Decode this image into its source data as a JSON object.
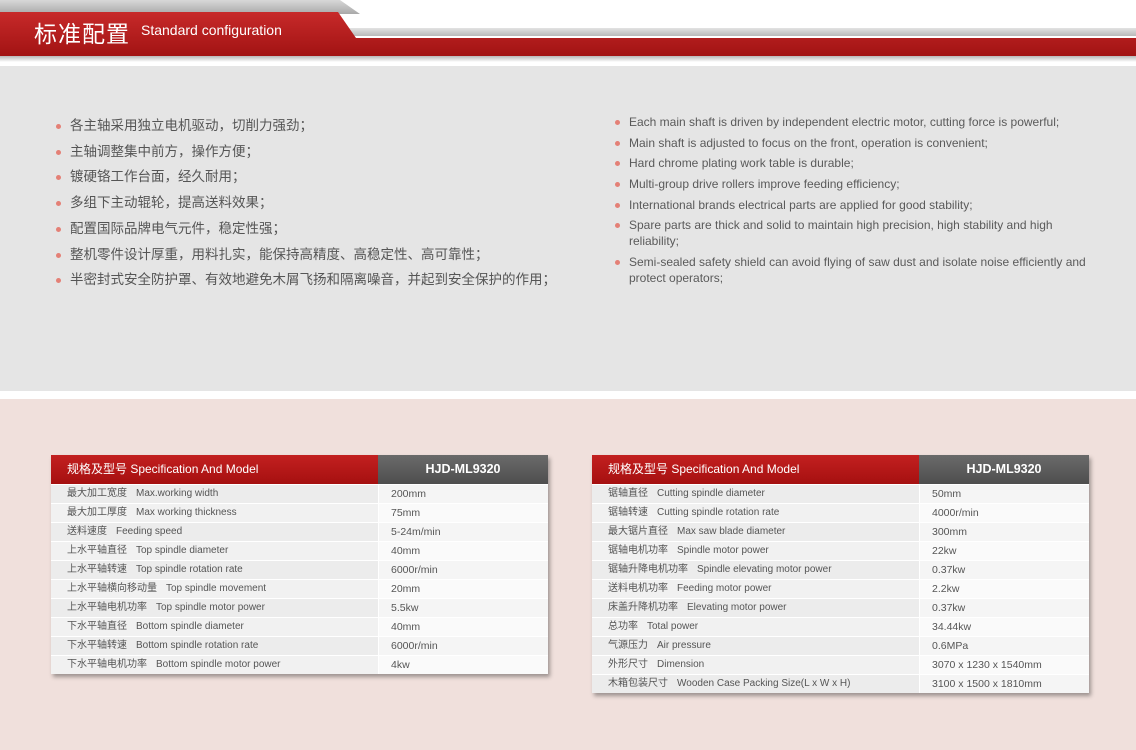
{
  "header": {
    "title_cn": "标准配置",
    "title_en": "Standard configuration",
    "accent": "#b71c1c"
  },
  "features_cn": [
    "各主轴采用独立电机驱动，切削力强劲；",
    "主轴调整集中前方，操作方便；",
    "镀硬铬工作台面，经久耐用；",
    "多组下主动辊轮，提高送料效果；",
    "配置国际品牌电气元件，稳定性强；",
    "整机零件设计厚重，用料扎实，能保持高精度、高稳定性、高可靠性；",
    "半密封式安全防护罩、有效地避免木屑飞扬和隔离噪音，并起到安全保护的作用；"
  ],
  "features_en": [
    "Each main shaft is driven by independent electric motor, cutting force is powerful;",
    "Main shaft is adjusted to focus on the front, operation is convenient;",
    "Hard chrome plating work table is durable;",
    "Multi-group drive rollers improve feeding efficiency;",
    "International brands electrical parts are applied for good stability;",
    "Spare parts are thick and solid to maintain high precision, high stability and high reliability;",
    "Semi-sealed safety shield can avoid flying of saw dust and isolate noise efficiently and protect operators;"
  ],
  "table_left": {
    "header_name": "规格及型号 Specification And Model",
    "header_model": "HJD-ML9320",
    "rows": [
      {
        "cn": "最大加工宽度",
        "en": "Max.working width",
        "value": "200mm"
      },
      {
        "cn": "最大加工厚度",
        "en": "Max working thickness",
        "value": "75mm"
      },
      {
        "cn": "送料速度",
        "en": "Feeding speed",
        "value": "5-24m/min"
      },
      {
        "cn": "上水平轴直径",
        "en": "Top spindle diameter",
        "value": "40mm"
      },
      {
        "cn": "上水平轴转速",
        "en": "Top spindle rotation rate",
        "value": "6000r/min"
      },
      {
        "cn": "上水平轴横向移动量",
        "en": "Top spindle movement",
        "value": "20mm"
      },
      {
        "cn": "上水平轴电机功率",
        "en": "Top spindle motor power",
        "value": "5.5kw"
      },
      {
        "cn": "下水平轴直径",
        "en": "Bottom spindle diameter",
        "value": "40mm"
      },
      {
        "cn": "下水平轴转速",
        "en": "Bottom spindle rotation rate",
        "value": "6000r/min"
      },
      {
        "cn": "下水平轴电机功率",
        "en": "Bottom spindle motor power",
        "value": "4kw"
      }
    ]
  },
  "table_right": {
    "header_name": "规格及型号 Specification And Model",
    "header_model": "HJD-ML9320",
    "rows": [
      {
        "cn": "锯轴直径",
        "en": "Cutting spindle diameter",
        "value": "50mm"
      },
      {
        "cn": "锯轴转速",
        "en": "Cutting spindle rotation rate",
        "value": "4000r/min"
      },
      {
        "cn": "最大锯片直径",
        "en": "Max saw blade diameter",
        "value": "300mm"
      },
      {
        "cn": "锯轴电机功率",
        "en": "Spindle motor power",
        "value": "22kw"
      },
      {
        "cn": "锯轴升降电机功率",
        "en": "Spindle elevating motor power",
        "value": "0.37kw"
      },
      {
        "cn": "送料电机功率",
        "en": "Feeding motor power",
        "value": "2.2kw"
      },
      {
        "cn": "床盖升降机功率",
        "en": "Elevating motor power",
        "value": "0.37kw"
      },
      {
        "cn": "总功率",
        "en": "Total power",
        "value": "34.44kw"
      },
      {
        "cn": "气源压力",
        "en": "Air pressure",
        "value": "0.6MPa"
      },
      {
        "cn": "外形尺寸",
        "en": "Dimension",
        "value": "3070 x 1230 x 1540mm"
      },
      {
        "cn": "木箱包装尺寸",
        "en": "Wooden Case Packing Size(L x W x H)",
        "value": "3100 x 1500 x 1810mm"
      }
    ]
  }
}
